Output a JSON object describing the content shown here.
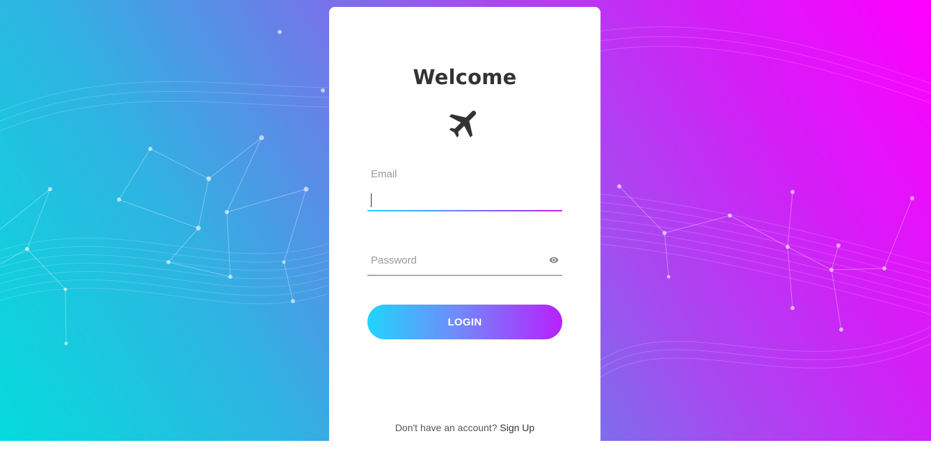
{
  "login": {
    "title": "Welcome",
    "email": {
      "label": "Email",
      "value": ""
    },
    "password": {
      "placeholder": "Password",
      "value": ""
    },
    "login_button": "LOGIN",
    "signup_prompt": "Don't have an account?",
    "signup_link": "Sign Up"
  },
  "icons": {
    "logo": "airplane-icon",
    "password_toggle": "eye-icon"
  },
  "colors": {
    "background_start": "#05dcdc",
    "background_end": "#ff00ff",
    "button_gradient_start": "#21d4fd",
    "button_gradient_end": "#b721ff",
    "text_dark": "#333333",
    "text_muted": "#999999"
  }
}
